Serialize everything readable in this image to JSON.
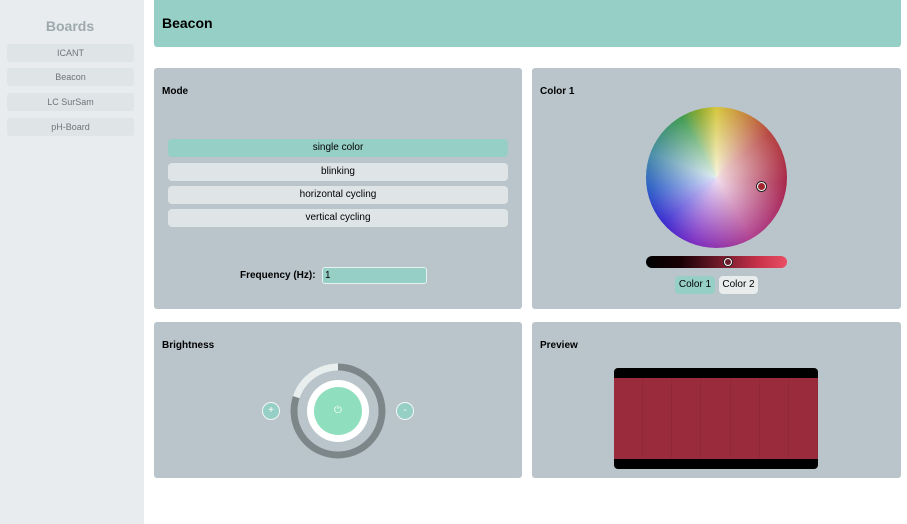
{
  "sidebar": {
    "title": "Boards",
    "items": [
      {
        "label": "ICANT"
      },
      {
        "label": "Beacon"
      },
      {
        "label": "LC SurSam"
      },
      {
        "label": "pH-Board"
      }
    ]
  },
  "header": {
    "title": "Beacon"
  },
  "mode_panel": {
    "title": "Mode",
    "options": [
      {
        "label": "single color",
        "active": true
      },
      {
        "label": "blinking",
        "active": false
      },
      {
        "label": "horizontal cycling",
        "active": false
      },
      {
        "label": "vertical cycling",
        "active": false
      }
    ],
    "frequency_label": "Frequency (Hz):",
    "frequency_value": "1"
  },
  "color_panel": {
    "title": "Color 1",
    "selected_color": "#9e2a3c",
    "tabs": [
      {
        "label": "Color 1",
        "active": true
      },
      {
        "label": "Color 2",
        "active": false
      }
    ]
  },
  "brightness_panel": {
    "title": "Brightness",
    "plus_label": "+",
    "minus_label": "-",
    "power_icon": "power-icon",
    "power_glyph": "⏻",
    "level": 0.8
  },
  "preview_panel": {
    "title": "Preview",
    "led_color": "#9a2b3c",
    "led_count": 7
  },
  "colors": {
    "accent": "#96cfc5",
    "panel": "#b9c5ca",
    "sidebar": "#e8ecee",
    "power": "#8fdfbf"
  }
}
